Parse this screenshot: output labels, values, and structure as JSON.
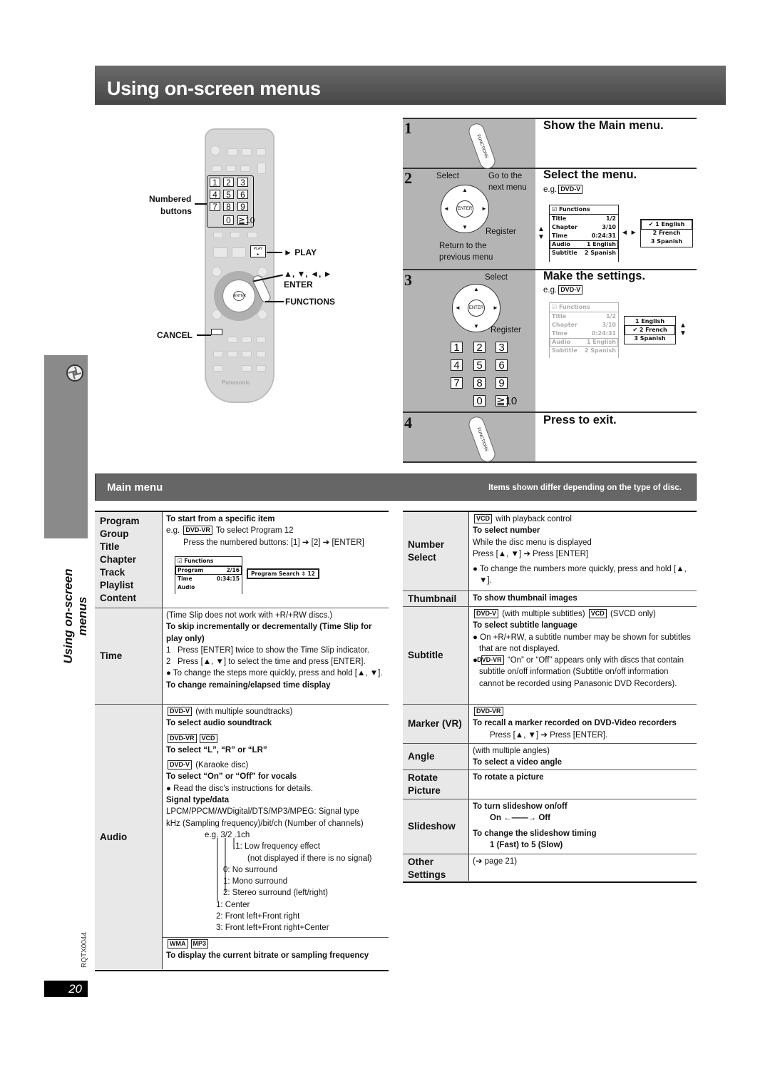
{
  "title": "Using on-screen menus",
  "side_label": "Using on-screen menus",
  "doc_code": "RQTX0044",
  "page_number": "20",
  "icons": {
    "side_tab": "disc-icon"
  },
  "remote": {
    "brand": "Panasonic",
    "keys": [
      "1",
      "2",
      "3",
      "4",
      "5",
      "6",
      "7",
      "8",
      "9",
      "0",
      "≧10"
    ],
    "play_key": "PLAY",
    "labels": {
      "numbered": "Numbered",
      "buttons": "buttons",
      "play": "► PLAY",
      "arrows": "▲, ▼, ◄, ►",
      "enter": "ENTER",
      "functions": "FUNCTIONS",
      "cancel": "CANCEL"
    }
  },
  "steps": [
    {
      "num": "1",
      "title": "Show the Main menu.",
      "button": "FUNCTIONS"
    },
    {
      "num": "2",
      "title": "Select the menu.",
      "eg": "e.g.",
      "badge": "DVD-V",
      "labels": {
        "select": "Select",
        "go_next_1": "Go to the",
        "go_next_2": "next menu",
        "register": "Register",
        "return_1": "Return to the",
        "return_2": "previous menu",
        "enter": "ENTER"
      }
    },
    {
      "num": "3",
      "title": "Make the settings.",
      "eg": "e.g.",
      "badge": "DVD-V",
      "labels": {
        "select": "Select",
        "register": "Register",
        "enter": "ENTER"
      },
      "keys": [
        "1",
        "2",
        "3",
        "4",
        "5",
        "6",
        "7",
        "8",
        "9",
        "0",
        "≧10"
      ]
    },
    {
      "num": "4",
      "title": "Press to exit.",
      "button": "FUNCTIONS"
    }
  ],
  "osd": {
    "header": "Functions",
    "rows": [
      {
        "label": "Title",
        "value": "1/2"
      },
      {
        "label": "Chapter",
        "value": "3/10"
      },
      {
        "label": "Time",
        "value": "0:24:31"
      },
      {
        "label": "Audio",
        "value": "1 English"
      },
      {
        "label": "Subtitle",
        "value": "2 Spanish"
      }
    ],
    "step2_languages": [
      "✔ 1 English",
      "2 French",
      "3 Spanish"
    ],
    "step3_languages": [
      "1 English",
      "✔ 2 French",
      "3 Spanish"
    ]
  },
  "main_menu": {
    "title": "Main menu",
    "note": "Items shown differ depending on the type of disc."
  },
  "program_osd": {
    "header": "Functions",
    "rows": [
      {
        "label": "Program",
        "value": "2/16"
      },
      {
        "label": "Time",
        "value": "0:34:15"
      },
      {
        "label": "Audio",
        "value": ""
      }
    ],
    "search": "Program Search ⇕ 12"
  },
  "left_table": [
    {
      "labels": [
        "Program",
        "Group",
        "Title",
        "Chapter",
        "Track",
        "Playlist",
        "Content"
      ],
      "lines": [
        {
          "style": "b",
          "parts": [
            "To start from a specific item"
          ]
        },
        {
          "style": "n",
          "parts": [
            "e.g. ",
            {
              "badge": "DVD-VR"
            },
            " To select Program 12"
          ]
        },
        {
          "style": "i1",
          "parts": [
            "Press the numbered buttons: [1] ➔ [2] ➔ [ENTER]"
          ]
        }
      ]
    },
    {
      "labels": [
        "Time"
      ],
      "lines": [
        {
          "style": "n",
          "parts": [
            "(Time Slip does not work with +R/+RW discs.)"
          ]
        },
        {
          "style": "b",
          "parts": [
            "To skip incrementally or decrementally (Time Slip for play only)"
          ]
        },
        {
          "style": "num",
          "parts": [
            "1   Press [ENTER] twice to show the Time Slip indicator."
          ]
        },
        {
          "style": "num",
          "parts": [
            "2   Press [▲, ▼] to select the time and press [ENTER]."
          ]
        },
        {
          "style": "bul i1",
          "parts": [
            "● To change the steps more quickly, press and hold [▲, ▼]."
          ]
        },
        {
          "style": "b",
          "parts": [
            "To change remaining/elapsed time display"
          ]
        }
      ]
    },
    {
      "labels": [
        "Audio"
      ],
      "lines": [
        {
          "style": "n",
          "parts": [
            {
              "badge": "DVD-V"
            },
            " (with multiple soundtracks)"
          ]
        },
        {
          "style": "b",
          "parts": [
            "To select audio soundtrack"
          ]
        },
        {
          "style": "n gap",
          "parts": [
            {
              "badge": "DVD-VR"
            },
            {
              "badge": "VCD"
            }
          ]
        },
        {
          "style": "b",
          "parts": [
            "To select “L”, “R” or “LR”"
          ]
        },
        {
          "style": "n gap",
          "parts": [
            {
              "badge": "DVD-V"
            },
            " (Karaoke disc)"
          ]
        },
        {
          "style": "b",
          "parts": [
            "To select “On” or “Off” for vocals"
          ]
        },
        {
          "style": "n",
          "parts": [
            "● Read the disc's instructions for details."
          ]
        },
        {
          "style": "b",
          "parts": [
            "Signal type/data"
          ]
        },
        {
          "style": "n",
          "parts": [
            "LPCM/PPCM/ꟿDigital/DTS/MP3/MPEG:  Signal type"
          ]
        },
        {
          "style": "n",
          "parts": [
            "kHz (Sampling frequency)/bit/ch (Number of channels)"
          ]
        },
        {
          "style": "i2",
          "parts": [
            "e.g.  3/2 .1ch"
          ]
        },
        {
          "style": "n",
          "text": ".1:  Low frequency effect"
        },
        {
          "style": "n",
          "text": "(not displayed if there is no signal)"
        },
        {
          "style": "n",
          "text": "0:  No surround"
        },
        {
          "style": "n",
          "text": "1:  Mono surround"
        },
        {
          "style": "n",
          "text": "2:  Stereo surround (left/right)"
        },
        {
          "style": "n",
          "text": "1:  Center"
        },
        {
          "style": "n",
          "text": "2:  Front left+Front right"
        },
        {
          "style": "n",
          "text": "3:  Front left+Front right+Center"
        }
      ],
      "sub": [
        {
          "style": "n",
          "parts": [
            {
              "badge": "WMA"
            },
            {
              "badge": "MP3"
            }
          ]
        },
        {
          "style": "b",
          "parts": [
            "To display the current bitrate or sampling frequency"
          ]
        }
      ]
    }
  ],
  "right_table": [
    {
      "labels": [
        "Number",
        "Select"
      ],
      "lines": [
        {
          "style": "n",
          "parts": [
            {
              "badge": "VCD"
            },
            " with playback control"
          ]
        },
        {
          "style": "b",
          "parts": [
            "To select number"
          ]
        },
        {
          "style": "n",
          "parts": [
            "While the disc menu is displayed"
          ]
        },
        {
          "style": "n",
          "parts": [
            "Press [▲, ▼] ➔ Press [ENTER]"
          ]
        },
        {
          "style": "bul gap",
          "parts": [
            "● To change the numbers more quickly, press and hold [▲, ▼]."
          ]
        }
      ]
    },
    {
      "labels": [
        "Thumbnail"
      ],
      "lines": [
        {
          "style": "b",
          "parts": [
            "To show thumbnail images"
          ]
        }
      ]
    },
    {
      "labels": [
        "Subtitle"
      ],
      "lines": [
        {
          "style": "n",
          "parts": [
            {
              "badge": "DVD-V"
            },
            " (with multiple subtitles) ",
            {
              "badge": "VCD"
            },
            " (SVCD only)"
          ]
        },
        {
          "style": "b",
          "parts": [
            "To select subtitle language"
          ]
        },
        {
          "style": "bul",
          "parts": [
            "● On +R/+RW, a subtitle number may be shown for subtitles that are not displayed."
          ]
        },
        {
          "style": "bul",
          "parts": [
            "● ",
            {
              "badge": "DVD-VR"
            },
            " “On” or “Off” appears only with discs that contain subtitle on/off information (Subtitle on/off information cannot be recorded using Panasonic DVD Recorders)."
          ]
        }
      ]
    },
    {
      "labels": [
        "Marker (VR)"
      ],
      "lines": [
        {
          "style": "n",
          "parts": [
            {
              "badge": "DVD-VR"
            }
          ]
        },
        {
          "style": "b",
          "parts": [
            "To recall a marker recorded on DVD-Video recorders"
          ]
        },
        {
          "style": "i1",
          "parts": [
            "Press [▲, ▼] ➔ Press [ENTER]."
          ]
        }
      ]
    },
    {
      "labels": [
        "Angle"
      ],
      "lines": [
        {
          "style": "n",
          "parts": [
            "(with multiple angles)"
          ]
        },
        {
          "style": "b",
          "parts": [
            "To select a video angle"
          ]
        }
      ]
    },
    {
      "labels": [
        "Rotate",
        "Picture"
      ],
      "top": true,
      "lines": [
        {
          "style": "b",
          "parts": [
            "To rotate a picture"
          ]
        }
      ]
    },
    {
      "labels": [
        "Slideshow"
      ],
      "lines": [
        {
          "style": "b",
          "parts": [
            "To turn slideshow on/off"
          ]
        },
        {
          "style": "b i1",
          "parts": [
            "On ←——→ Off"
          ]
        },
        {
          "style": "b gap",
          "parts": [
            "To change the slideshow timing"
          ]
        },
        {
          "style": "b i1",
          "parts": [
            "1 (Fast) to 5 (Slow)"
          ]
        }
      ]
    },
    {
      "labels": [
        "Other",
        "Settings"
      ],
      "top": true,
      "lines": [
        {
          "style": "n",
          "parts": [
            "(➔ page 21)"
          ]
        }
      ]
    }
  ]
}
